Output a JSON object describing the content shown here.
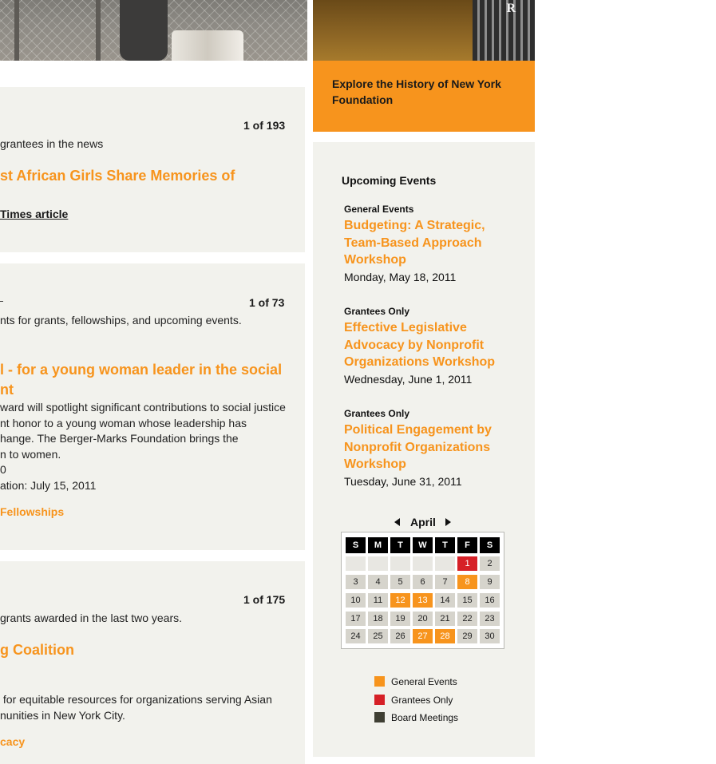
{
  "explore": {
    "text": "Explore the History of New York Foundation"
  },
  "news": {
    "count": "1 of 193",
    "description": "grantees in the news",
    "headline": "st African Girls Share Memories of",
    "link": "Times article"
  },
  "opportunities": {
    "count": "1 of 73",
    "description": "nts for grants, fellowships, and upcoming events.",
    "headline_line1": "l - for a young woman leader in the social",
    "headline_line2": "nt",
    "body_lines": [
      "ward will spotlight significant contributions to social justice",
      "nt honor to a young woman whose leadership has",
      "hange. The Berger-Marks Foundation brings the",
      "n to women.",
      "0",
      "ation: July 15, 2011"
    ],
    "link": "Fellowships"
  },
  "grants": {
    "count": "1 of 175",
    "description": "grants awarded in the last two years.",
    "headline": "g Coalition",
    "body_lines": [
      " for equitable resources for organizations serving Asian",
      "nunities in New York City."
    ],
    "link": "cacy"
  },
  "events": {
    "title": "Upcoming Events",
    "items": [
      {
        "category": "General Events",
        "name_lines": [
          "Budgeting: A Strategic,",
          "Team-Based Approach",
          "Workshop"
        ],
        "date": "Monday, May 18, 2011"
      },
      {
        "category": "Grantees Only",
        "name_lines": [
          "Effective Legislative",
          "Advocacy by Nonprofit",
          "Organizations Workshop"
        ],
        "date": "Wednesday, June 1, 2011"
      },
      {
        "category": "Grantees Only",
        "name_lines": [
          "Political Engagement by",
          "Nonprofit Organizations",
          "Workshop"
        ],
        "date": "Tuesday, June 31, 2011"
      }
    ]
  },
  "calendar": {
    "month": "April",
    "weekdays": [
      "S",
      "M",
      "T",
      "W",
      "T",
      "F",
      "S"
    ],
    "weeks": [
      [
        "",
        "",
        "",
        "",
        "",
        "1",
        "2"
      ],
      [
        "3",
        "4",
        "5",
        "6",
        "7",
        "8",
        "9"
      ],
      [
        "10",
        "11",
        "12",
        "13",
        "14",
        "15",
        "16"
      ],
      [
        "17",
        "18",
        "19",
        "20",
        "21",
        "22",
        "23"
      ],
      [
        "24",
        "25",
        "26",
        "27",
        "28",
        "29",
        "30"
      ]
    ],
    "general_event_days": [
      "8",
      "12",
      "13",
      "27",
      "28"
    ],
    "grantee_only_days": [
      "1"
    ]
  },
  "legend": {
    "items": [
      {
        "label": "General Events",
        "color": "#f7941d"
      },
      {
        "label": "Grantees Only",
        "color": "#d62027"
      },
      {
        "label": "Board Meetings",
        "color": "#3f3f33"
      }
    ]
  },
  "photo_sign": "R"
}
